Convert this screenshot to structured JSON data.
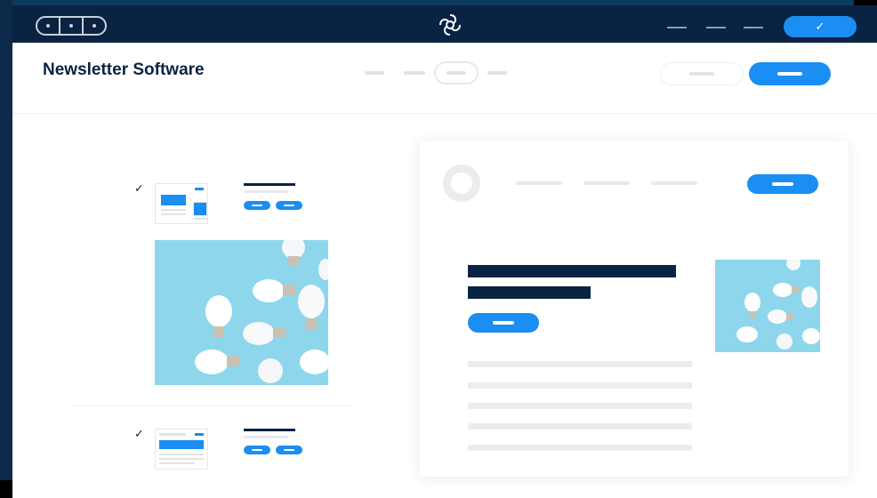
{
  "app": {
    "title": "Newsletter Software",
    "logo_icon": "swirl-logo-icon",
    "confirm_icon": "checkmark-icon",
    "confirm_glyph": "✓"
  },
  "colors": {
    "navy": "#0a2342",
    "accent": "#1a8ef2",
    "photo_bg": "#8ed6ec",
    "placeholder": "#e6e9ed"
  },
  "templates": [
    {
      "name": "template-1",
      "checked": true,
      "check_glyph": "✓"
    },
    {
      "name": "template-2",
      "checked": true,
      "check_glyph": "✓"
    }
  ]
}
